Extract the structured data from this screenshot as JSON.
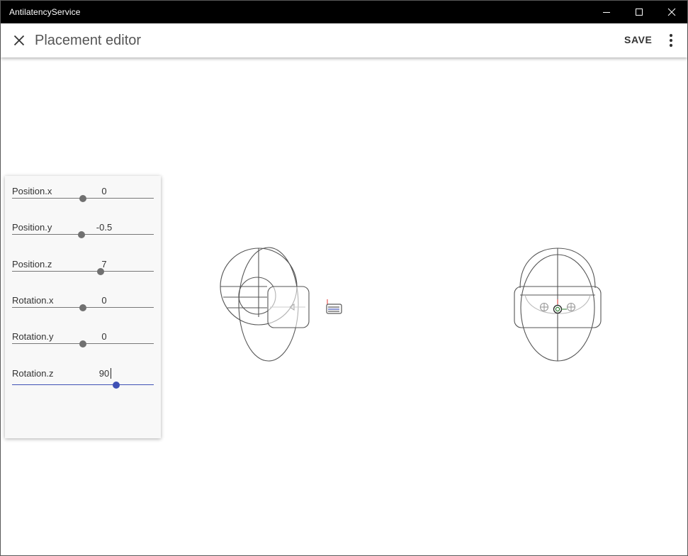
{
  "window": {
    "title": "AntilatencyService",
    "controls": {
      "minimize": "minimize-icon",
      "maximize": "maximize-icon",
      "close": "close-icon"
    }
  },
  "appbar": {
    "title": "Placement editor",
    "save_label": "SAVE",
    "close_icon": "close-icon",
    "more_icon": "more-vert-icon"
  },
  "panel": {
    "fields": [
      {
        "label": "Position.x",
        "value": "0"
      },
      {
        "label": "Position.y",
        "value": "-0.5"
      },
      {
        "label": "Position.z",
        "value": "7"
      },
      {
        "label": "Rotation.x",
        "value": "0"
      },
      {
        "label": "Rotation.y",
        "value": "0"
      },
      {
        "label": "Rotation.z",
        "value": "90"
      }
    ]
  },
  "colors": {
    "accent": "#3f51b5",
    "slider_thumb": "#707070",
    "titlebar": "#000000"
  },
  "scene": {
    "views": [
      "head-side-view",
      "head-front-view"
    ]
  }
}
